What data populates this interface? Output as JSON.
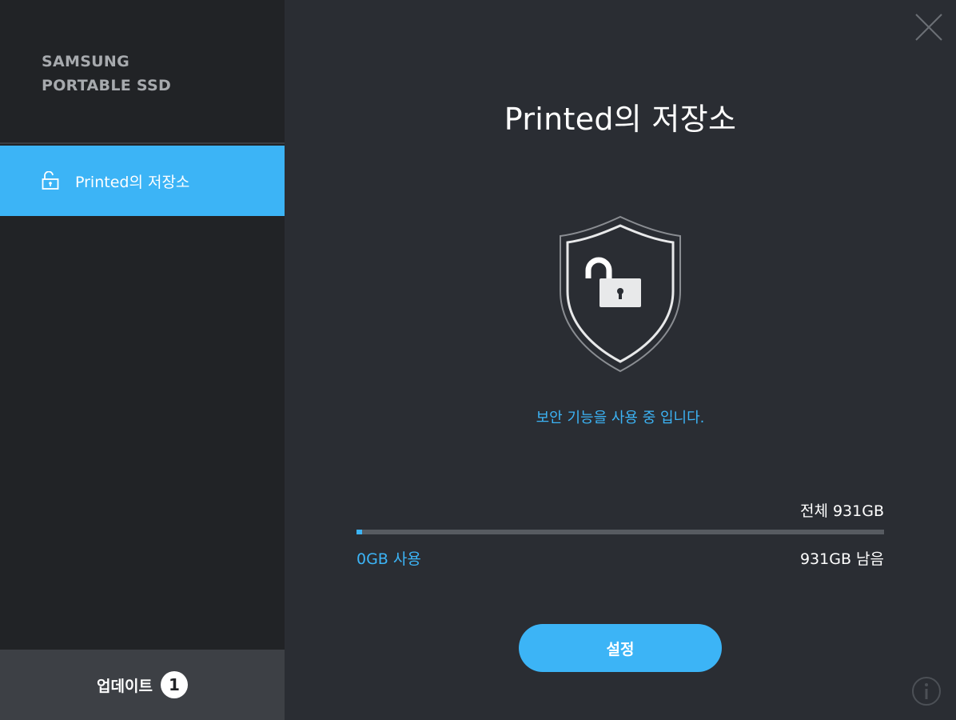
{
  "app": {
    "brand_line1": "SAMSUNG",
    "brand_line2": "PORTABLE SSD"
  },
  "sidebar": {
    "items": [
      {
        "label": "Printed의 저장소",
        "icon": "unlock-icon",
        "selected": true
      }
    ],
    "update": {
      "label": "업데이트",
      "count": "1"
    }
  },
  "main": {
    "title": "Printed의 저장소",
    "shield_icon": "shield-unlocked-icon",
    "security_message": "보안 기능을 사용 중 입니다.",
    "storage": {
      "total_label": "전체 931GB",
      "used_label": "0GB 사용",
      "remaining_label": "931GB 남음",
      "used_fraction": 0.01
    },
    "settings_label": "설정"
  },
  "colors": {
    "accent": "#3cb4f6",
    "sidebar_bg": "#212326",
    "main_bg": "#2a2d33",
    "update_bg": "#3d4045"
  }
}
